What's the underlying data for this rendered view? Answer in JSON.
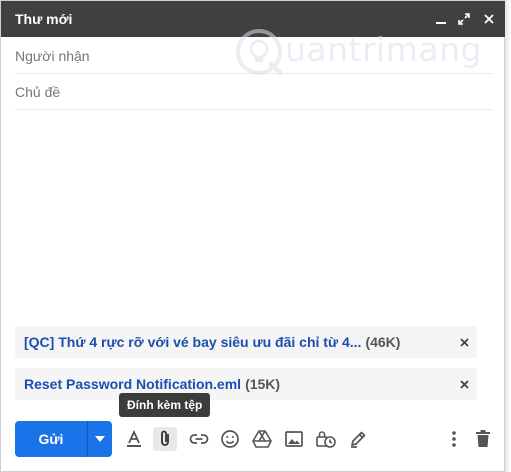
{
  "window": {
    "title": "Thư mới"
  },
  "fields": {
    "to_placeholder": "Người nhận",
    "subject_placeholder": "Chủ đề"
  },
  "watermark": {
    "text": "uantrimang"
  },
  "attachments": [
    {
      "name": "[QC] Thứ 4 rực rỡ với vé bay siêu ưu đãi chỉ từ 4...",
      "size": "(46K)"
    },
    {
      "name": "Reset Password Notification.eml",
      "size": "(15K)"
    }
  ],
  "tooltip": {
    "text": "Đính kèm tệp"
  },
  "toolbar": {
    "send_label": "Gửi"
  },
  "colors": {
    "titlebar": "#404040",
    "send_button": "#1a73e8",
    "attachment_link": "#1a4fb0"
  }
}
